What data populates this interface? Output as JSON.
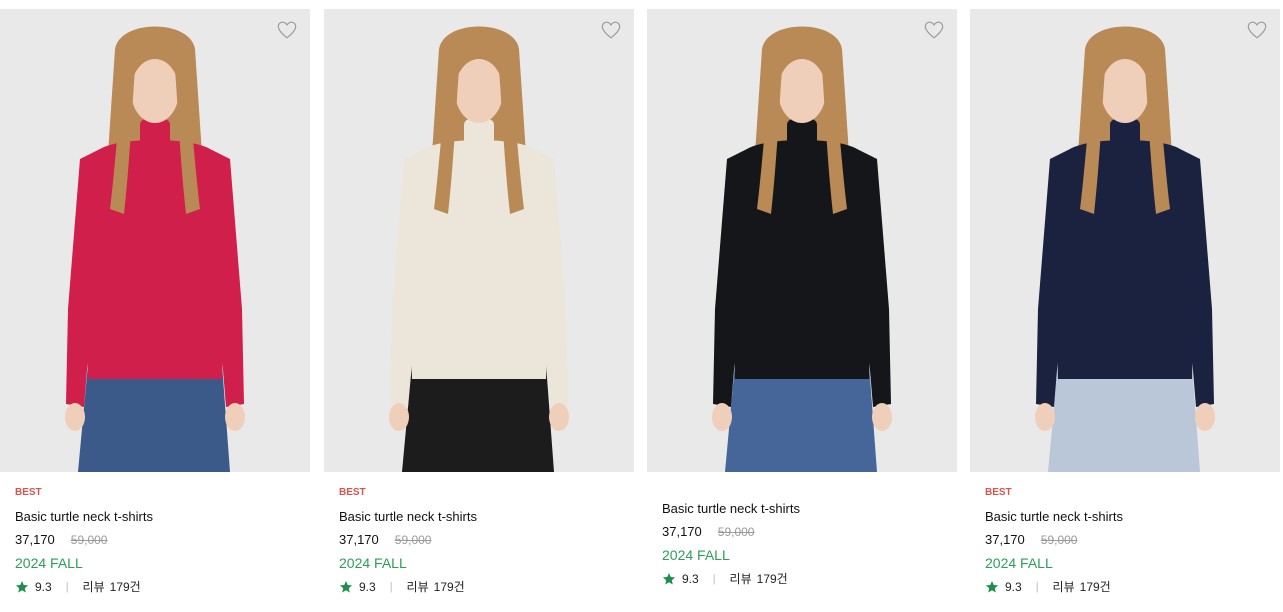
{
  "products": [
    {
      "badge": "BEST",
      "name": "Basic turtle neck t-shirts",
      "price": "37,170",
      "original_price": "59,000",
      "season": "2024 FALL",
      "rating": "9.3",
      "separator": "|",
      "review_label": "리뷰",
      "review_count": "179건",
      "colors": {
        "top": "#d01f4a",
        "bottom": "#3b5a8a"
      }
    },
    {
      "badge": "BEST",
      "name": "Basic turtle neck t-shirts",
      "price": "37,170",
      "original_price": "59,000",
      "season": "2024 FALL",
      "rating": "9.3",
      "separator": "|",
      "review_label": "리뷰",
      "review_count": "179건",
      "colors": {
        "top": "#ebe6d9",
        "bottom": "#1c1c1c"
      }
    },
    {
      "badge": "",
      "name": "Basic turtle neck t-shirts",
      "price": "37,170",
      "original_price": "59,000",
      "season": "2024 FALL",
      "rating": "9.3",
      "separator": "|",
      "review_label": "리뷰",
      "review_count": "179건",
      "colors": {
        "top": "#15161a",
        "bottom": "#46669a"
      }
    },
    {
      "badge": "BEST",
      "name": "Basic turtle neck t-shirts",
      "price": "37,170",
      "original_price": "59,000",
      "season": "2024 FALL",
      "rating": "9.3",
      "separator": "|",
      "review_label": "리뷰",
      "review_count": "179건",
      "colors": {
        "top": "#1a2240",
        "bottom": "#b9c7d8"
      }
    }
  ],
  "icons": {
    "wishlist": "heart-outline-icon",
    "rating": "star-icon"
  },
  "theme": {
    "badge": "#d9534f",
    "season": "#2b9f58",
    "star": "#1e8f4a",
    "photo_bg": "#e9e9e9"
  }
}
